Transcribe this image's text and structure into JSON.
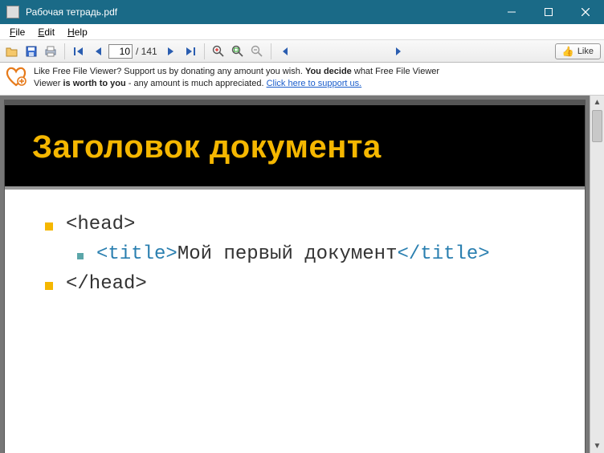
{
  "window": {
    "title": "Рабочая тетрадь.pdf"
  },
  "menu": {
    "file": "File",
    "edit": "Edit",
    "help": "Help"
  },
  "toolbar": {
    "current_page": "10",
    "total_pages": "/ 141",
    "like_label": "Like"
  },
  "banner": {
    "t1": "Like Free File Viewer? Support us by donating any amount you wish. ",
    "t2_bold": "You decide",
    "t3": " what Free File Viewer ",
    "t4_bold": "is worth to you",
    "t5": " - any amount is much appreciated. ",
    "link": "Click here to support us."
  },
  "slide": {
    "title": "Заголовок документа",
    "line1": "<head>",
    "line2_open": "<title>",
    "line2_text": "Мой первый документ",
    "line2_close": "</title>",
    "line3": "</head>"
  }
}
